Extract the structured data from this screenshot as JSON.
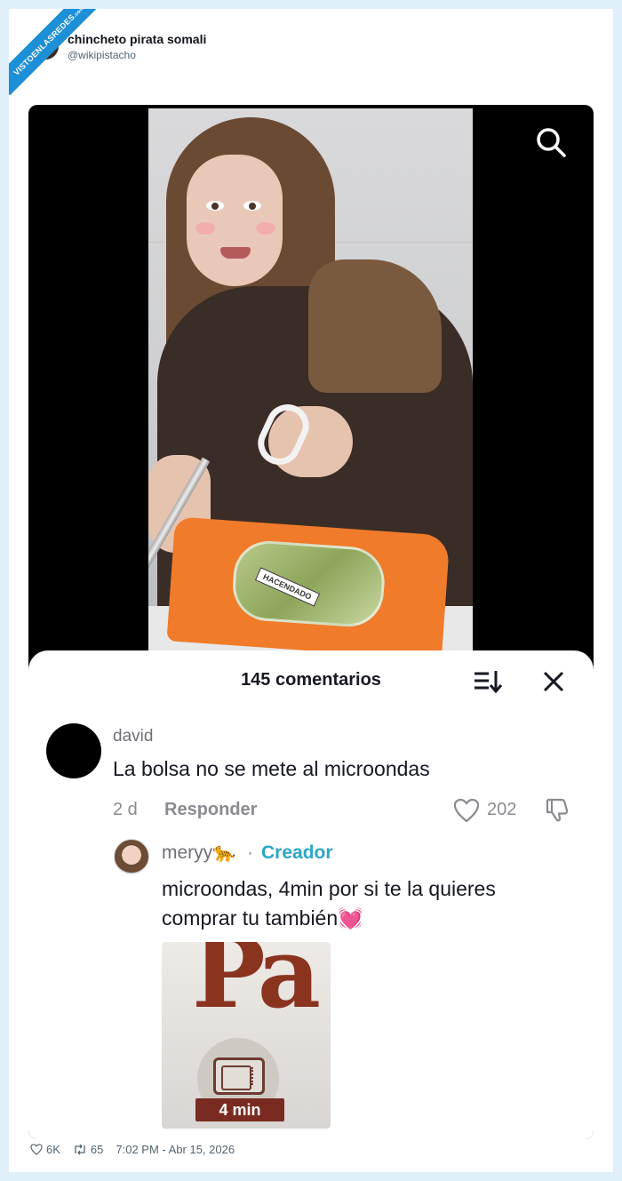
{
  "watermark": {
    "text": "VISTOENLASREDES",
    "suffix": ".com"
  },
  "tweet": {
    "author_name": "chincheto pirata somali",
    "author_handle": "@wikipistacho"
  },
  "video": {
    "bag_brand": "HACENDADO"
  },
  "comments_sheet": {
    "title": "145 comentarios",
    "comment": {
      "user": "david",
      "text": "La bolsa no se mete al microondas",
      "time": "2 d",
      "reply_label": "Responder",
      "likes": "202"
    },
    "reply": {
      "user": "meryy🐆",
      "separator": "·",
      "badge": "Creador",
      "text": "microondas, 4min por si te la quieres comprar tu también",
      "emoji": "💓",
      "thumbnail_time": "4 min"
    }
  },
  "footer": {
    "likes": "6K",
    "retweets": "65",
    "timestamp": "7:02 PM - Abr 15, 2026"
  },
  "colors": {
    "page_bg": "#dff0fb",
    "ribbon": "#1d8fd6",
    "creator_badge": "#2aa6c8",
    "bag_orange": "#f07b2a"
  }
}
